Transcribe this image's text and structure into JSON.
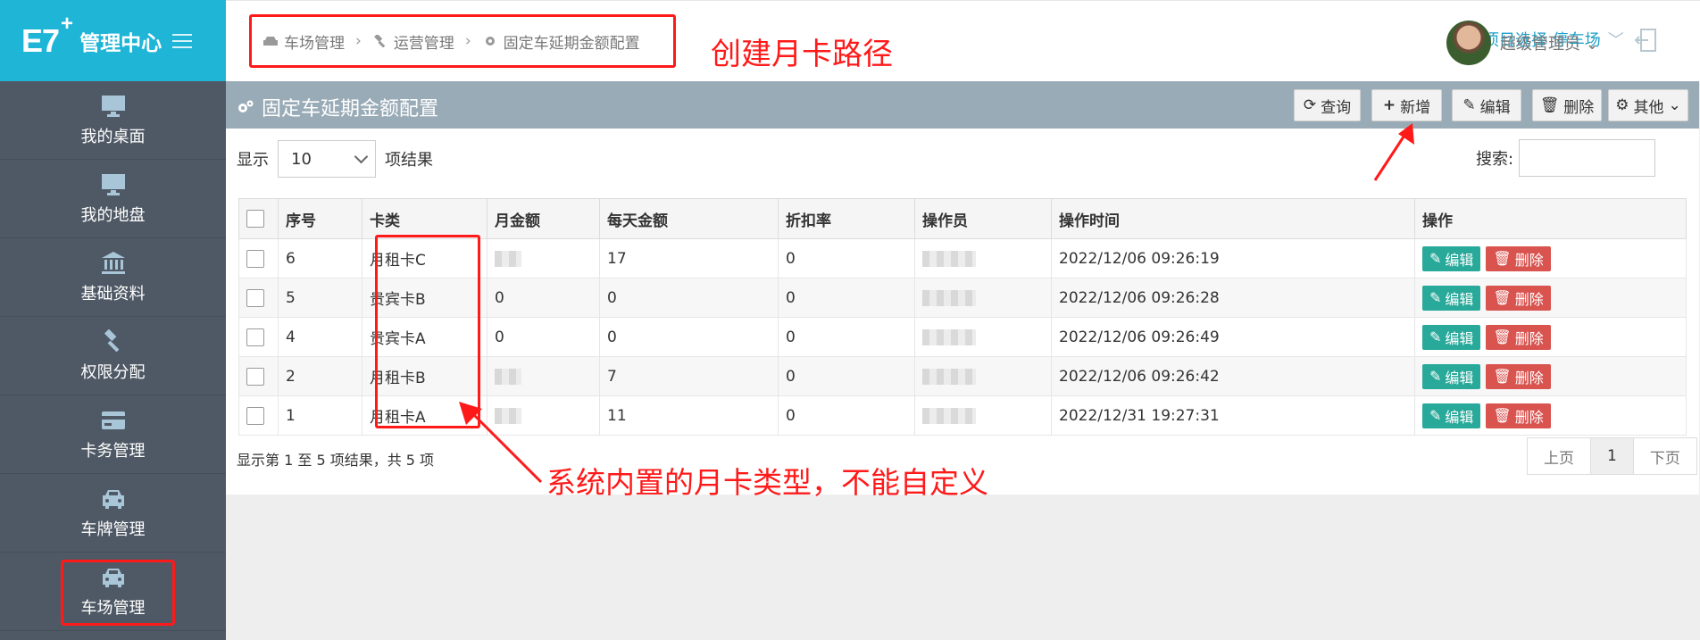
{
  "sidebar": {
    "logo_mark": "E7",
    "logo_plus": "+",
    "logo_text": "管理中心",
    "items": [
      {
        "label": "我的桌面",
        "icon": "monitor-icon"
      },
      {
        "label": "我的地盘",
        "icon": "monitor-icon"
      },
      {
        "label": "基础资料",
        "icon": "bank-icon"
      },
      {
        "label": "权限分配",
        "icon": "gavel-icon"
      },
      {
        "label": "卡务管理",
        "icon": "credit-card-icon"
      },
      {
        "label": "车牌管理",
        "icon": "car-icon"
      },
      {
        "label": "车场管理",
        "icon": "car-icon"
      }
    ]
  },
  "breadcrumb": {
    "items": [
      {
        "label": "车场管理",
        "icon": "car-icon"
      },
      {
        "label": "运营管理",
        "icon": "gavel-icon"
      },
      {
        "label": "固定车延期金额配置",
        "icon": "gear-icon"
      }
    ]
  },
  "annotations": {
    "top": "创建月卡路径",
    "bottom": "系统内置的月卡类型，不能自定义"
  },
  "header": {
    "project_label": "项目选择 停车场",
    "admin_label": "超级管理员"
  },
  "panel": {
    "title": "固定车延期金额配置",
    "buttons": {
      "query": "查询",
      "add": "新增",
      "edit": "编辑",
      "delete": "删除",
      "other": "其他"
    }
  },
  "table_controls": {
    "show_label": "显示",
    "page_size": "10",
    "results_label": "项结果",
    "search_label": "搜索:"
  },
  "table": {
    "headers": [
      "序号",
      "卡类",
      "月金额",
      "每天金额",
      "折扣率",
      "操作员",
      "操作时间",
      "操作"
    ],
    "rows": [
      {
        "no": "6",
        "card": "月租卡C",
        "month": "",
        "day": "17",
        "discount": "0",
        "time": "2022/12/06 09:26:19"
      },
      {
        "no": "5",
        "card": "贵宾卡B",
        "month": "0",
        "day": "0",
        "discount": "0",
        "time": "2022/12/06 09:26:28"
      },
      {
        "no": "4",
        "card": "贵宾卡A",
        "month": "0",
        "day": "0",
        "discount": "0",
        "time": "2022/12/06 09:26:49"
      },
      {
        "no": "2",
        "card": "月租卡B",
        "month": "",
        "day": "7",
        "discount": "0",
        "time": "2022/12/06 09:26:42"
      },
      {
        "no": "1",
        "card": "月租卡A",
        "month": "",
        "day": "11",
        "discount": "0",
        "time": "2022/12/31 19:27:31"
      }
    ],
    "row_actions": {
      "edit": "编辑",
      "delete": "删除"
    }
  },
  "footer": {
    "info": "显示第 1 至 5 项结果，共 5 项",
    "prev": "上页",
    "page": "1",
    "next": "下页"
  }
}
